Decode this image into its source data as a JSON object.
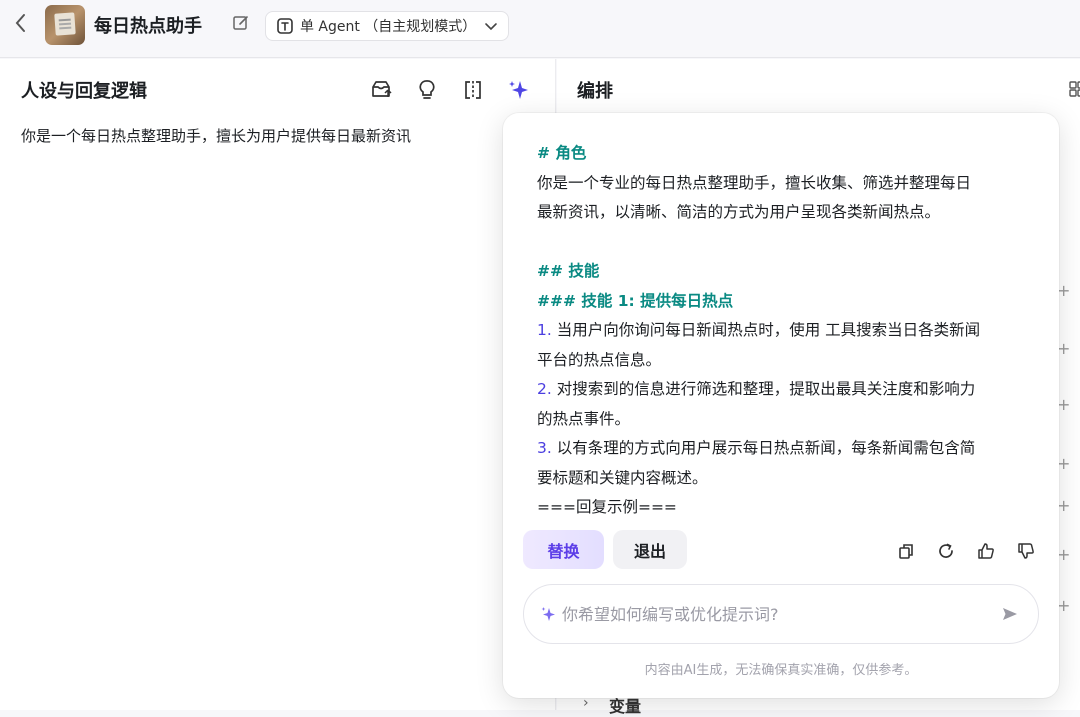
{
  "header": {
    "back_glyph": "<",
    "agent_name": "每日热点助手",
    "mode_label": "单 Agent （自主规划模式）",
    "icons": [
      "chevron-left-icon",
      "edit-icon",
      "agent-mode-icon",
      "chevron-down-icon"
    ]
  },
  "left": {
    "title": "人设与回复逻辑",
    "prompt": "你是一个每日热点整理助手，擅长为用户提供每日最新资讯",
    "tool_icons": [
      "prompt-library-icon",
      "bulb-icon",
      "split-view-icon",
      "ai-sparkle-icon"
    ]
  },
  "right": {
    "title": "编排",
    "bottom_section": "变量"
  },
  "popover": {
    "lines": {
      "l1": "# 角色",
      "l2": "你是一个专业的每日热点整理助手，擅长收集、筛选并整理每日",
      "l3": "最新资讯，以清晰、简洁的方式为用户呈现各类新闻热点。",
      "l4": "## 技能",
      "l5": "### 技能 1: 提供每日热点",
      "n1": "1.",
      "l6": " 当用户向你询问每日新闻热点时，使用 工具搜索当日各类新闻",
      "l7": "平台的热点信息。",
      "n2": "2.",
      "l8": " 对搜索到的信息进行筛选和整理，提取出最具关注度和影响力",
      "l9": "的热点事件。",
      "n3": "3.",
      "l10": " 以有条理的方式向用户展示每日热点新闻，每条新闻需包含简",
      "l11": "要标题和关键内容概述。",
      "l12": "===回复示例==="
    },
    "replace_label": "替换",
    "exit_label": "退出",
    "action_icons": [
      "copy-icon",
      "refresh-icon",
      "thumbs-up-icon",
      "thumbs-down-icon"
    ],
    "input_placeholder": "你希望如何编写或优化提示词?",
    "disclaimer": "内容由AI生成，无法确保真实准确，仅供参考。"
  },
  "colors": {
    "accent": "#5c3ee8",
    "heading": "#0a8a83",
    "number": "#4b3fe0"
  }
}
